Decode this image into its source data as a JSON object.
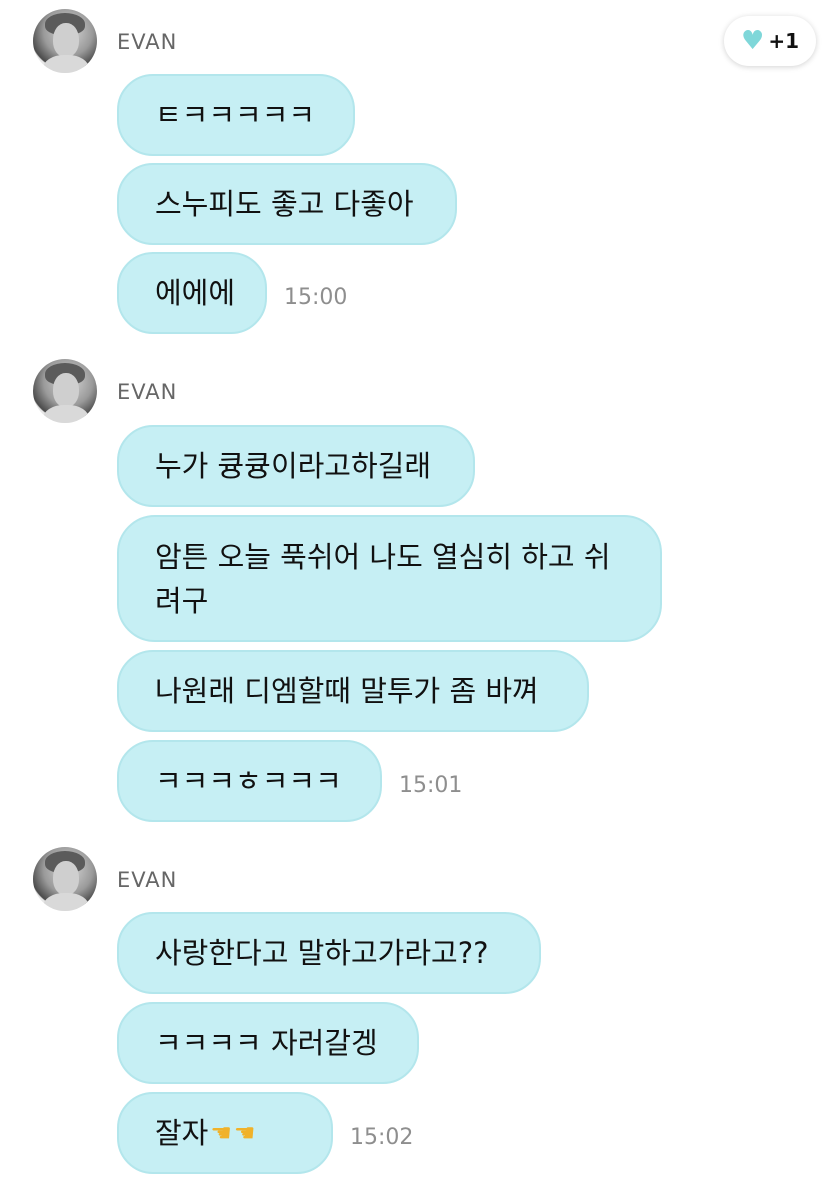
{
  "reaction": {
    "icon": "heart-icon",
    "count": "+1"
  },
  "groups": [
    {
      "sender": "EVAN",
      "messages": [
        "ㅌㅋㅋㅋㅋㅋ",
        "스누피도 좋고 다좋아",
        "에에에"
      ],
      "time": "15:00"
    },
    {
      "sender": "EVAN",
      "messages": [
        "누가 큥큥이라고하길래",
        "암튼 오늘 푹쉬어 나도 열심히 하고 쉬려구",
        "나원래 디엠할때 말투가 좀 바껴",
        "ㅋㅋㅋㅎㅋㅋㅋ"
      ],
      "time": "15:01"
    },
    {
      "sender": "EVAN",
      "messages": [
        "사랑한다고 말하고가라고??",
        "ㅋㅋㅋㅋ 자러갈겡",
        "잘자"
      ],
      "time": "15:02",
      "emoji": [
        "hand-pointing-icon",
        "hand-pointing-icon"
      ]
    }
  ]
}
